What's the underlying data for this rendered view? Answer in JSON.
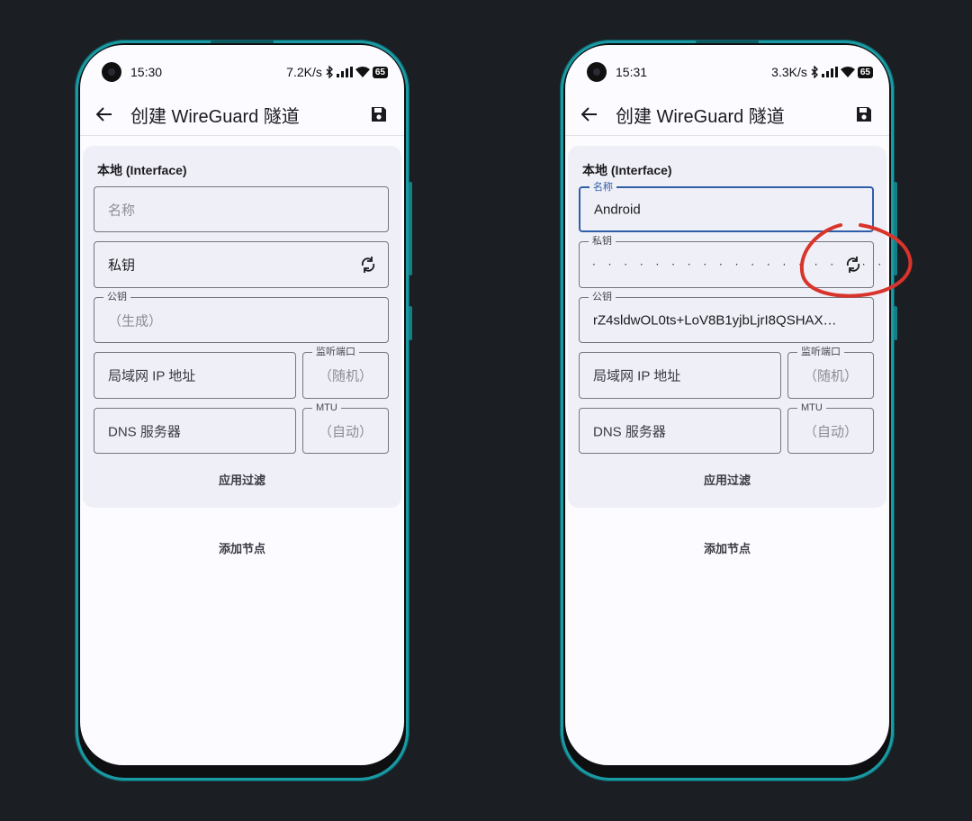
{
  "phones": [
    {
      "status": {
        "time": "15:30",
        "speed": "7.2K/s",
        "battery": "65"
      },
      "title": "创建 WireGuard 隧道",
      "section_title": "本地 (Interface)",
      "fields": {
        "name": {
          "label": "",
          "placeholder": "名称",
          "value": ""
        },
        "private_key": {
          "label": "",
          "placeholder": "私钥",
          "value": ""
        },
        "public_key": {
          "label": "公钥",
          "placeholder": "（生成）",
          "value": ""
        },
        "lan_ip": {
          "placeholder": "局域网 IP 地址"
        },
        "listen_port": {
          "label": "监听端口",
          "placeholder": "（随机）"
        },
        "dns": {
          "placeholder": "DNS 服务器"
        },
        "mtu": {
          "label": "MTU",
          "placeholder": "（自动）"
        }
      },
      "filter_button": "应用过滤",
      "add_peer_button": "添加节点"
    },
    {
      "status": {
        "time": "15:31",
        "speed": "3.3K/s",
        "battery": "65"
      },
      "title": "创建 WireGuard 隧道",
      "section_title": "本地 (Interface)",
      "fields": {
        "name": {
          "label": "名称",
          "value": "Android"
        },
        "private_key": {
          "label": "私钥",
          "value": "· · · · · · · · · · · · · · · · · · · · · · ·"
        },
        "public_key": {
          "label": "公钥",
          "value": "rZ4sldwOL0ts+LoV8B1yjbLjrI8QSHAX…"
        },
        "lan_ip": {
          "placeholder": "局域网 IP 地址"
        },
        "listen_port": {
          "label": "监听端口",
          "placeholder": "（随机）"
        },
        "dns": {
          "placeholder": "DNS 服务器"
        },
        "mtu": {
          "label": "MTU",
          "placeholder": "（自动）"
        }
      },
      "filter_button": "应用过滤",
      "add_peer_button": "添加节点"
    }
  ],
  "icons": [
    "back-arrow-icon",
    "save-icon",
    "refresh-icon",
    "bluetooth-icon",
    "signal-icon",
    "wifi-icon"
  ],
  "colors": {
    "accent": "#2f5ea8",
    "frame": "#1a9aa3",
    "annotation": "#d9342b",
    "card": "#efeff7"
  }
}
